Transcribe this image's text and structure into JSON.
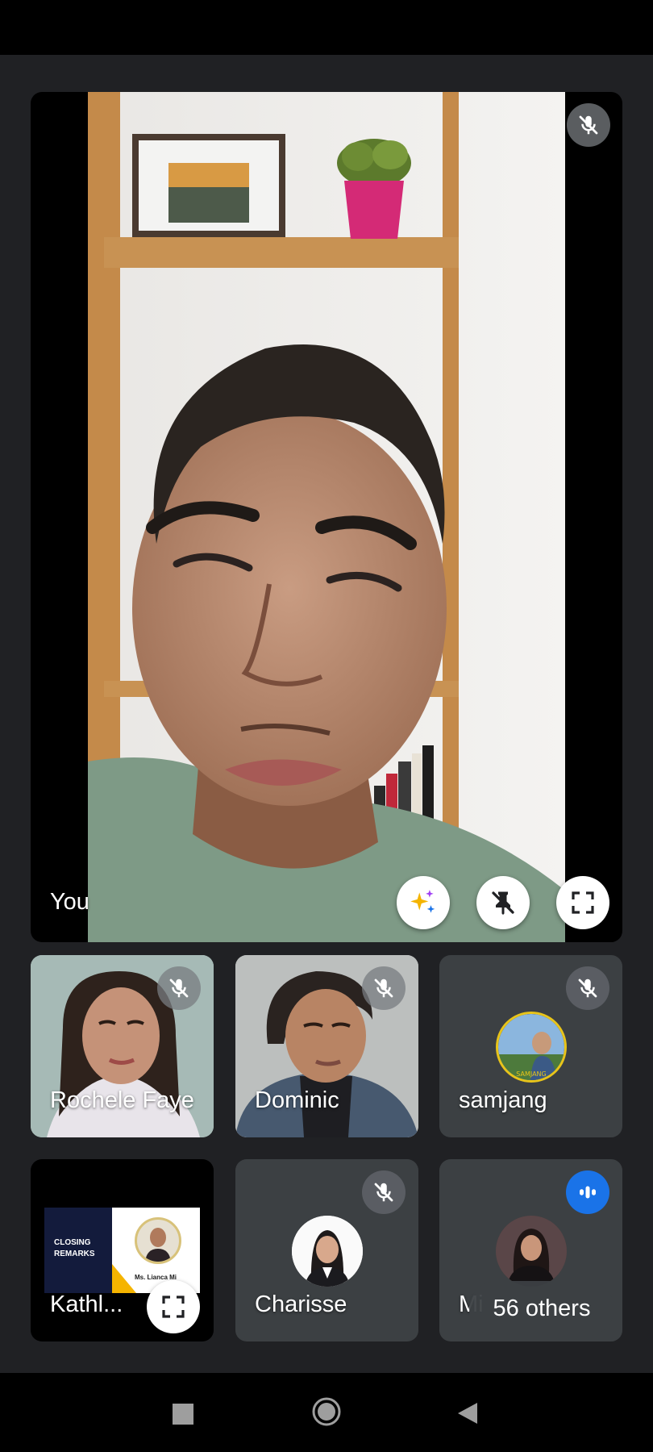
{
  "main_tile": {
    "name": "You"
  },
  "participants": [
    {
      "name": "Rochele Faye"
    },
    {
      "name": "Dominic"
    },
    {
      "name": "samjang"
    },
    {
      "name": "Kathl..."
    },
    {
      "name": "Charisse"
    },
    {
      "name": "Mi"
    }
  ],
  "presentation_slide": {
    "title_line1": "CLOSING",
    "title_line2": "REMARKS",
    "speaker": "Ms. Lianca Mi"
  },
  "avatar_badge": "SAMJANG",
  "others": {
    "label": "56 others"
  },
  "icons": {
    "mute": "mic-off-icon",
    "effects": "sparkle-effects-icon",
    "unpin": "unpin-icon",
    "fullscreen": "fullscreen-icon",
    "speaking": "audio-level-icon",
    "nav_recent": "square-recent-apps-icon",
    "nav_home": "circle-home-icon",
    "nav_back": "triangle-back-icon"
  },
  "colors": {
    "app_background": "#202124",
    "tile_background": "#3c4043",
    "speaking_indicator": "#1a73e8"
  }
}
